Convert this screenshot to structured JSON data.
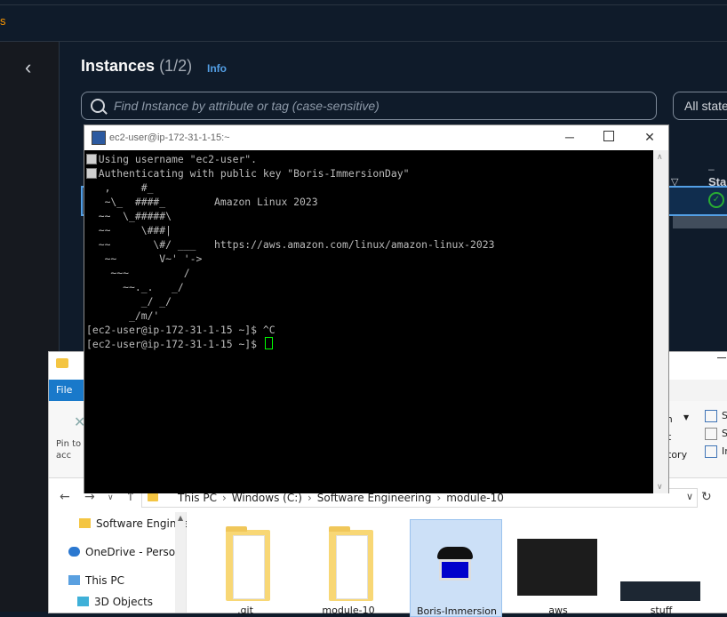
{
  "aws": {
    "topbar_crumb": "s",
    "instances_title": "Instances",
    "instances_count": "(1/2)",
    "info_link": "Info",
    "search_placeholder": "Find Instance by attribute or tag (case-sensitive)",
    "state_filter": "All state",
    "status_column": "Sta",
    "dash": "–"
  },
  "explorer": {
    "file_tab": "File",
    "pin_label": "Pin to Quick acc",
    "ribbon_right": [
      "en",
      "t",
      "tory"
    ],
    "ribbon_far": [
      "S",
      "S",
      "In"
    ],
    "address_path": [
      "This PC",
      "Windows (C:)",
      "Software Engineering",
      "module-10"
    ],
    "nav_items": [
      {
        "label": "Software Engineering",
        "icon": "folder-icon"
      },
      {
        "label": "OneDrive - Personal",
        "icon": "onedrive-icon"
      },
      {
        "label": "This PC",
        "icon": "computer-icon"
      },
      {
        "label": "3D Objects",
        "icon": "cube-icon"
      }
    ],
    "tiles": [
      {
        "label": ".git",
        "kind": "folder"
      },
      {
        "label": "module-10",
        "kind": "folder"
      },
      {
        "label": "Boris-Immersion",
        "kind": "putty"
      },
      {
        "label": "aws",
        "kind": "screenshot"
      },
      {
        "label": "stuff",
        "kind": "screenshot"
      }
    ]
  },
  "putty": {
    "title": "ec2-user@ip-172-31-1-15:~",
    "lines": [
      "  Using username \"ec2-user\".",
      "  Authenticating with public key \"Boris-ImmersionDay\"",
      "   ,     #_",
      "   ~\\_  ####_        Amazon Linux 2023",
      "  ~~  \\_#####\\",
      "  ~~     \\###|",
      "  ~~       \\#/ ___   https://aws.amazon.com/linux/amazon-linux-2023",
      "   ~~       V~' '->",
      "    ~~~         /",
      "      ~~._.   _/",
      "         _/ _/",
      "       _/m/'",
      "[ec2-user@ip-172-31-1-15 ~]$ ^C",
      "[ec2-user@ip-172-31-1-15 ~]$ "
    ]
  }
}
